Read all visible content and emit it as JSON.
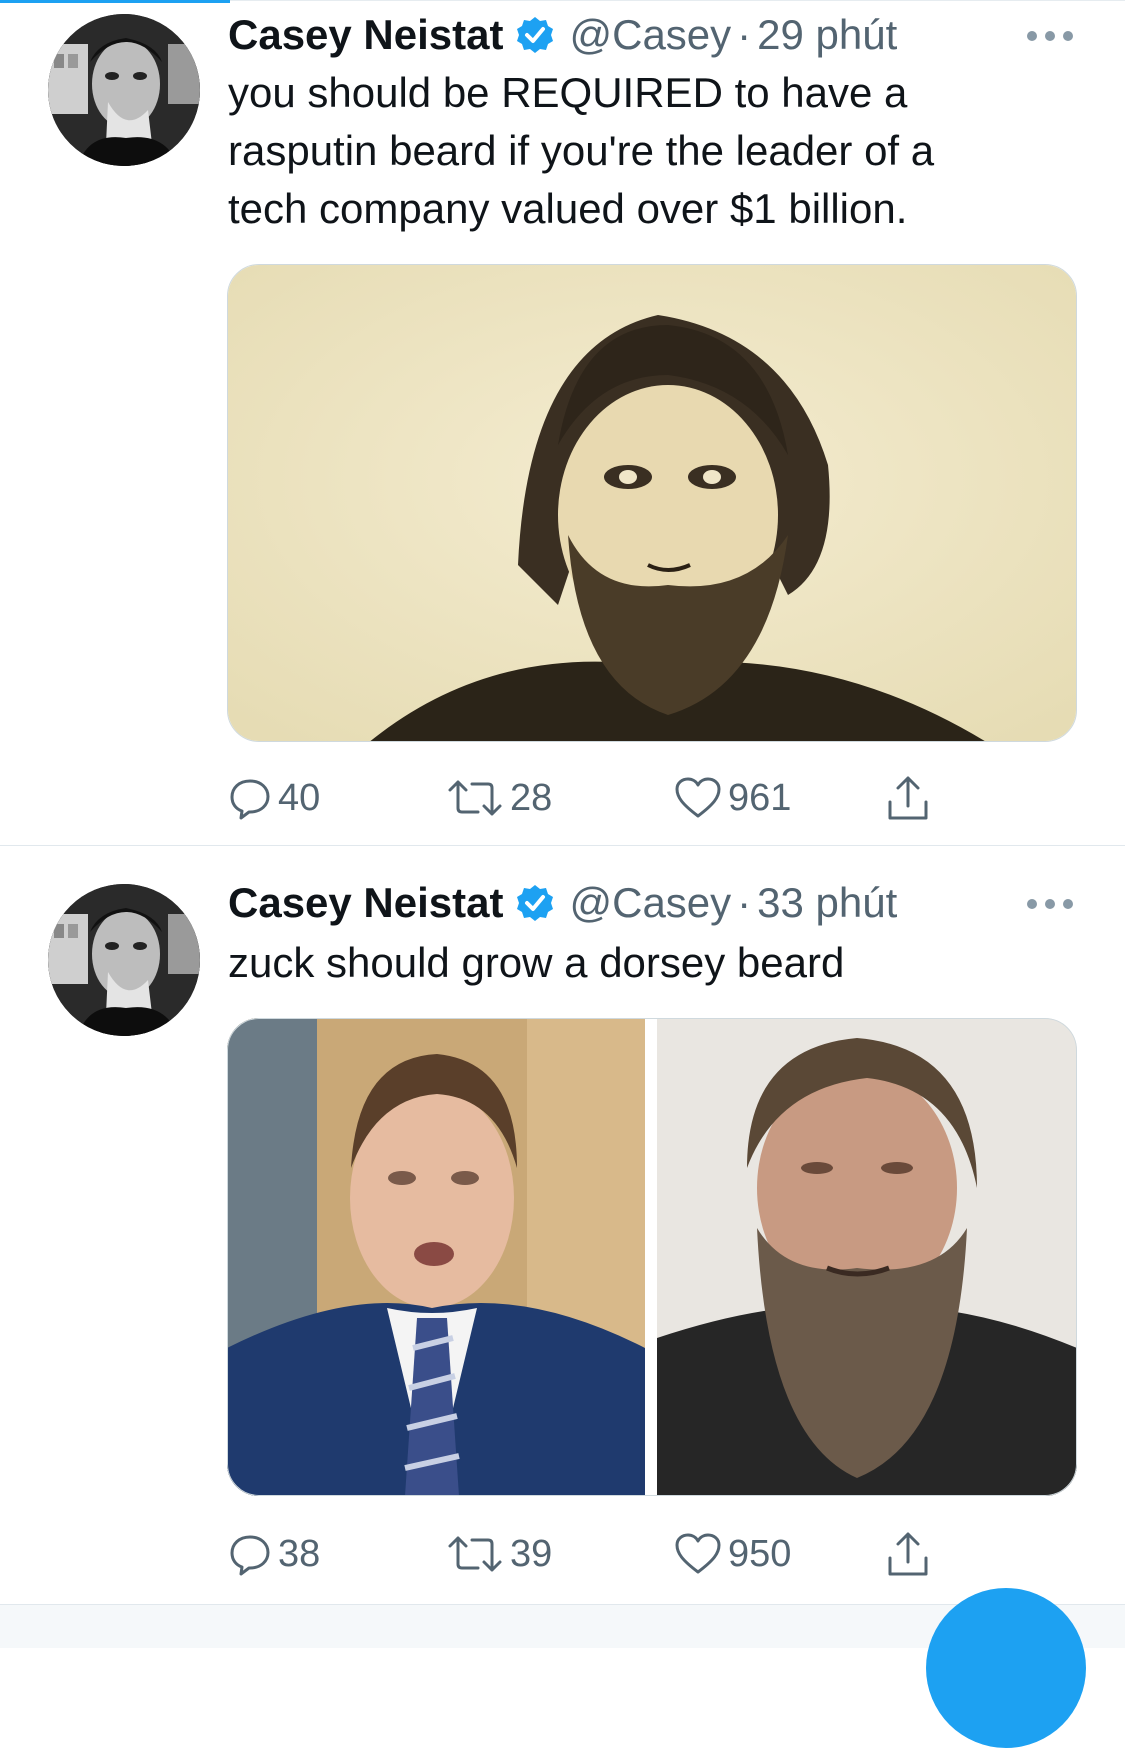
{
  "tweets": [
    {
      "author": {
        "name": "Casey Neistat",
        "handle": "@Casey",
        "verified": true
      },
      "separator": "·",
      "time": "29 phút",
      "text_lines": [
        "you should be REQUIRED to have a",
        "rasputin beard if you're the leader of a",
        "tech company valued over $1 billion."
      ],
      "media": {
        "type": "photo",
        "subject": "sepia portrait of bearded man"
      },
      "stats": {
        "replies": "40",
        "retweets": "28",
        "likes": "961"
      }
    },
    {
      "author": {
        "name": "Casey Neistat",
        "handle": "@Casey",
        "verified": true
      },
      "separator": "·",
      "time": "33 phút",
      "text_lines": [
        "zuck should grow a dorsey beard"
      ],
      "media": {
        "type": "photo-pair",
        "subjects": [
          "man in blue suit and striped tie",
          "man with long beard"
        ]
      },
      "stats": {
        "replies": "38",
        "retweets": "39",
        "likes": "950"
      }
    }
  ],
  "icons": {
    "reply": "speech-bubble-icon",
    "retweet": "retweet-icon",
    "like": "heart-icon",
    "share": "share-upload-icon",
    "more": "more-dots-icon",
    "verified": "verified-badge-icon",
    "compose": "compose-fab"
  },
  "colors": {
    "accent": "#1da1f2",
    "text_primary": "#0f1419",
    "text_secondary": "#536471",
    "divider": "#e1e8ed"
  }
}
